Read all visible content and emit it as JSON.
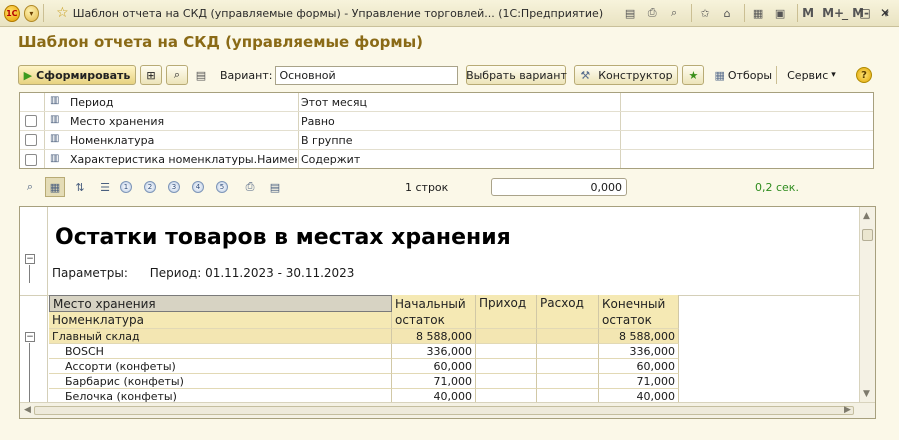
{
  "window": {
    "title": "Шаблон отчета на СКД (управляемые формы) - Управление торговлей... (1С:Предприятие)",
    "logo_text": "1С",
    "mem_buttons": [
      "M",
      "M+",
      "M-"
    ]
  },
  "form": {
    "title": "Шаблон отчета на СКД (управляемые формы)"
  },
  "toolbar": {
    "generate_label": "Сформировать",
    "variant_label": "Вариант:",
    "variant_value": "Основной",
    "select_variant_label": "Выбрать вариант",
    "constructor_label": "Конструктор",
    "filters_label": "Отборы",
    "service_label": "Сервис",
    "help_label": "?"
  },
  "filters": [
    {
      "name": "Период",
      "condition": "Этот месяц",
      "has_checkbox": false
    },
    {
      "name": "Место хранения",
      "condition": "Равно",
      "has_checkbox": true
    },
    {
      "name": "Номенклатура",
      "condition": "В группе",
      "has_checkbox": true
    },
    {
      "name": "Характеристика номенклатуры.Наименов...",
      "condition": "Содержит",
      "has_checkbox": true
    }
  ],
  "status": {
    "page_numbers": [
      "1",
      "2",
      "3",
      "4",
      "5"
    ],
    "rows_text": "1 строк",
    "progress_value": "0,000",
    "elapsed": "0,2 сек."
  },
  "report": {
    "title": "Остатки товаров в местах хранения",
    "params_label": "Параметры:",
    "params_value": "Период: 01.11.2023 - 30.11.2023",
    "header": {
      "col1_line1": "Место хранения",
      "col1_line2": "Номенклатура",
      "start_line1": "Начальный",
      "start_line2": "остаток",
      "income": "Приход",
      "expense": "Расход",
      "end_line1": "Конечный",
      "end_line2": "остаток"
    },
    "rows": [
      {
        "name": "Главный склад",
        "start": "8 588,000",
        "income": "",
        "expense": "",
        "end": "8 588,000",
        "group": true
      },
      {
        "name": "BOSCH",
        "start": "336,000",
        "income": "",
        "expense": "",
        "end": "336,000",
        "group": false
      },
      {
        "name": "Ассорти (конфеты)",
        "start": "60,000",
        "income": "",
        "expense": "",
        "end": "60,000",
        "group": false
      },
      {
        "name": "Барбарис (конфеты)",
        "start": "71,000",
        "income": "",
        "expense": "",
        "end": "71,000",
        "group": false
      },
      {
        "name": "Белочка (конфеты)",
        "start": "40,000",
        "income": "",
        "expense": "",
        "end": "40,000",
        "group": false
      }
    ]
  }
}
